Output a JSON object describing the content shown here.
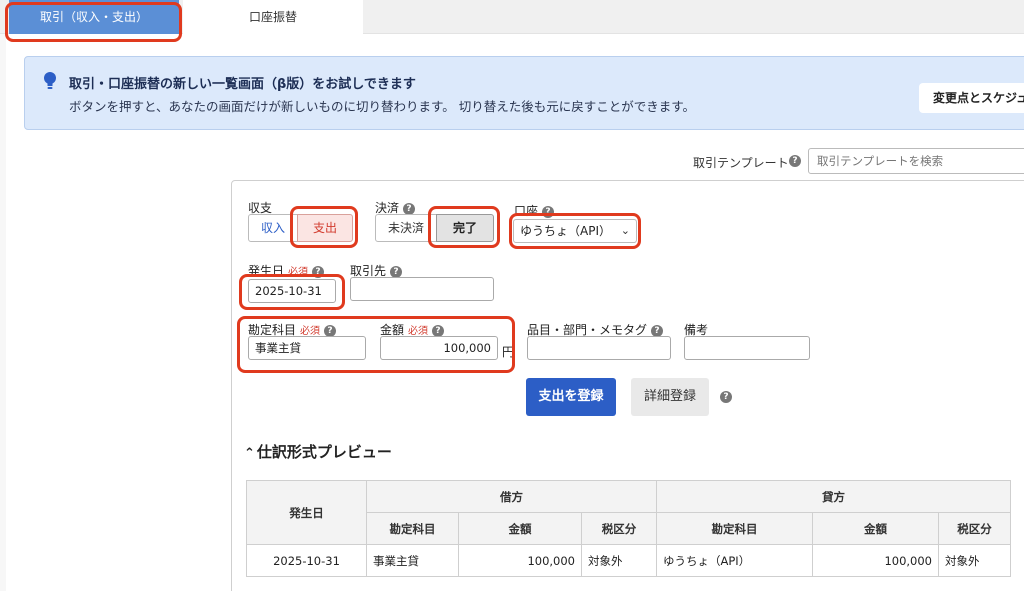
{
  "tabs": [
    {
      "label": "取引（収入・支出）",
      "active": true
    },
    {
      "label": "口座振替",
      "active": false
    }
  ],
  "banner": {
    "icon": "lightbulb-icon",
    "title": "取引・口座振替の新しい一覧画面（β版）をお試しできます",
    "subtitle": "ボタンを押すと、あなたの画面だけが新しいものに切り替わります。 切り替えた後も元に戻すことができます。",
    "button_label": "変更点とスケジュ"
  },
  "template": {
    "label": "取引テンプレート",
    "placeholder": "取引テンプレートを検索"
  },
  "form": {
    "type_label": "収支",
    "type_income": "収入",
    "type_expense": "支出",
    "type_selected": "支出",
    "settle_label": "決済",
    "settle_unsettled": "未決済",
    "settle_done": "完了",
    "settle_selected": "完了",
    "account_label": "口座",
    "account_value": "ゆうちょ（API）",
    "date_label": "発生日",
    "required": "必須",
    "date_value": "2025-10-31",
    "partner_label": "取引先",
    "partner_value": "",
    "subject_label": "勘定科目",
    "subject_value": "事業主貸",
    "amount_label": "金額",
    "amount_value": "100,000",
    "currency": "円",
    "tags_label": "品目・部門・メモタグ",
    "tags_value": "",
    "memo_label": "備考",
    "memo_value": "",
    "submit_label": "支出を登録",
    "detail_label": "詳細登録"
  },
  "preview": {
    "title": "仕訳形式プレビュー",
    "headers": {
      "date": "発生日",
      "debit": "借方",
      "credit": "貸方",
      "subject": "勘定科目",
      "amount": "金額",
      "tax": "税区分"
    },
    "row": {
      "date": "2025-10-31",
      "debit_subject": "事業主貸",
      "debit_amount": "100,000",
      "debit_tax": "対象外",
      "credit_subject": "ゆうちょ（API）",
      "credit_amount": "100,000",
      "credit_tax": "対象外"
    }
  },
  "colors": {
    "primary": "#2c5ec6",
    "tab_active": "#5b8fd6",
    "expense": "#d23b2e",
    "banner_bg": "#dce9fb",
    "highlight": "#e03a1e"
  }
}
